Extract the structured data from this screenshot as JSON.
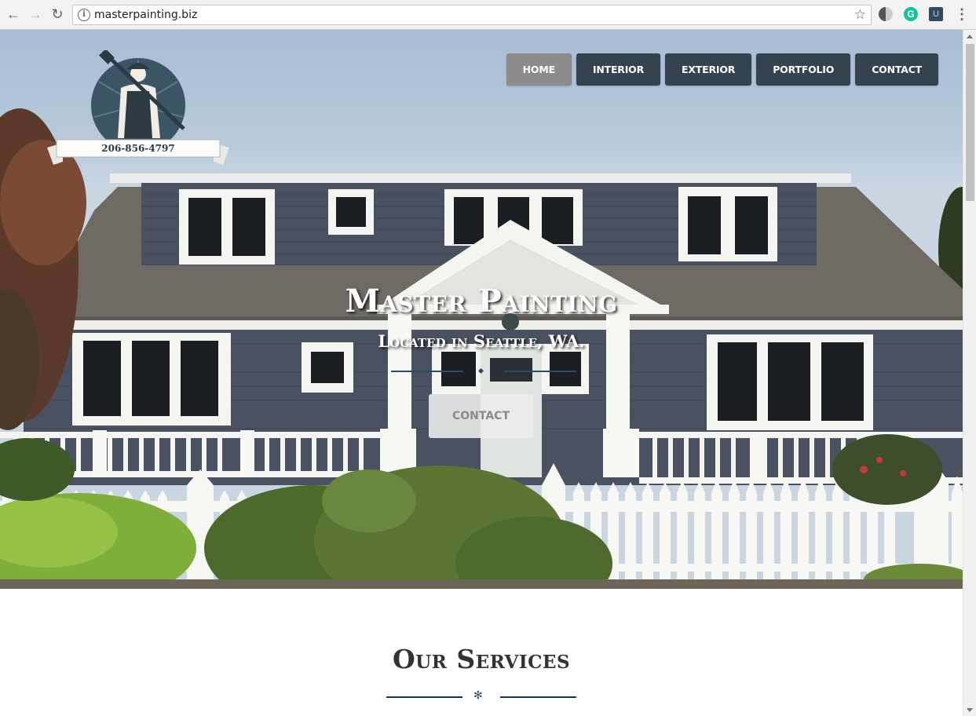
{
  "browser": {
    "url": "masterpainting.biz",
    "icons": [
      "back-arrow-icon",
      "forward-arrow-icon",
      "reload-icon",
      "site-info-icon",
      "bookmark-star-icon",
      "halfmoon-extension-icon",
      "grammarly-extension-icon",
      "u-extension-icon",
      "menu-dots-icon"
    ],
    "glyphs": {
      "back": "←",
      "forward": "→",
      "reload": "↻",
      "info": "i",
      "star": "☆",
      "grammarly": "G",
      "u_ext": "U",
      "menu": "⋮"
    }
  },
  "nav": {
    "items": [
      {
        "label": "HOME",
        "active": true
      },
      {
        "label": "INTERIOR"
      },
      {
        "label": "EXTERIOR"
      },
      {
        "label": "PORTFOLIO"
      },
      {
        "label": "CONTACT"
      }
    ]
  },
  "logo": {
    "phone": "206-856-4797"
  },
  "hero": {
    "title": "Master Painting",
    "subtitle": "Located in Seattle, WA.",
    "cta_label": "CONTACT"
  },
  "services": {
    "title": "Our Services",
    "divider_glyph": "✻"
  },
  "colors": {
    "nav_bg": "#34434f",
    "nav_active_bg": "#8c8c8c",
    "accent": "#2f4a63",
    "house_siding": "#4a5160",
    "trim": "#f4f4f0"
  }
}
